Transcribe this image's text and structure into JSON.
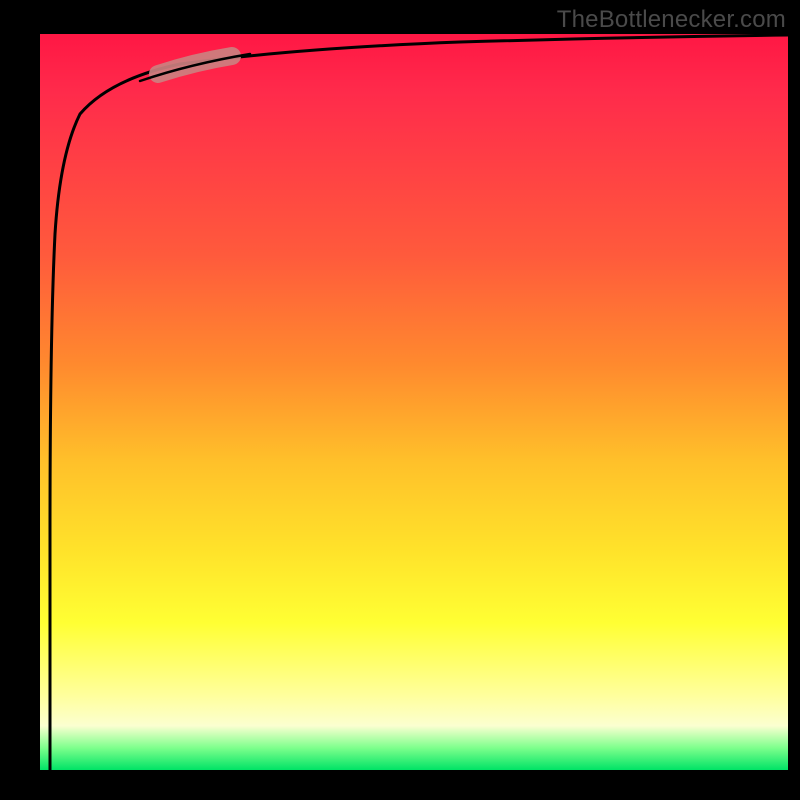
{
  "attribution": "TheBottlenecker.com",
  "colors": {
    "gradient_top": "#ff1744",
    "gradient_mid1": "#ff8a2e",
    "gradient_mid2": "#ffff33",
    "gradient_bottom": "#00e366",
    "curve": "#000000",
    "highlight": "#cc8080",
    "frame": "#000000",
    "attribution_text": "#4a4a4a"
  },
  "chart_data": {
    "type": "line",
    "title": "",
    "xlabel": "",
    "ylabel": "",
    "xlim": [
      0,
      100
    ],
    "ylim": [
      0,
      100
    ],
    "grid": false,
    "legend": false,
    "annotations": [
      "TheBottlenecker.com"
    ],
    "series": [
      {
        "name": "curve",
        "x": [
          1.3,
          1.3,
          1.4,
          1.6,
          2.0,
          2.7,
          5.3,
          9.4,
          18.7,
          34.8,
          56.1,
          80.2,
          100
        ],
        "y": [
          0,
          32,
          60,
          73,
          84,
          89,
          94,
          96,
          97.5,
          98.5,
          99.2,
          99.6,
          99.9
        ]
      }
    ],
    "highlight_range_x": [
      15,
      26
    ],
    "background_gradient": {
      "direction": "vertical",
      "stops": [
        {
          "pos": 0.0,
          "color": "#ff1744"
        },
        {
          "pos": 0.45,
          "color": "#ff8a2e"
        },
        {
          "pos": 0.8,
          "color": "#ffff33"
        },
        {
          "pos": 0.94,
          "color": "#fbffd0"
        },
        {
          "pos": 1.0,
          "color": "#00e366"
        }
      ]
    }
  }
}
